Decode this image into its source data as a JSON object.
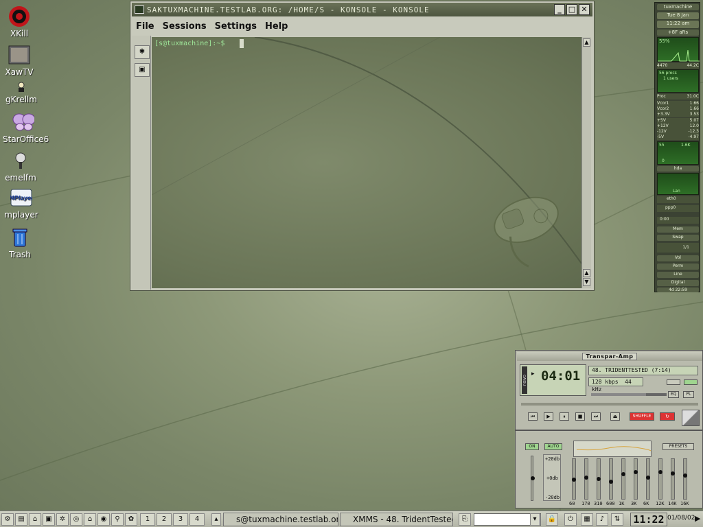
{
  "desktop_icons": [
    {
      "label": "XKill",
      "icon": "xkill-target-icon"
    },
    {
      "label": "XawTV",
      "icon": "xawtv-tv-icon"
    },
    {
      "label": "gKrellm",
      "icon": "gkrellm-monitor-icon"
    },
    {
      "label": "StarOffice6",
      "icon": "staroffice-butterfly-icon"
    },
    {
      "label": "emelfm",
      "icon": "emelfm-filemanager-icon"
    },
    {
      "label": "mplayer",
      "icon": "mplayer-icon"
    },
    {
      "label": "Trash",
      "icon": "trash-can-icon"
    }
  ],
  "konsole": {
    "title": "SAKTUXMACHINE.TESTLAB.ORG: /HOME/S - KONSOLE - KONSOLE",
    "menu": [
      "File",
      "Sessions",
      "Settings",
      "Help"
    ],
    "prompt": "[s@tuxmachine]:~$",
    "colors": {
      "prompt": "#9fe79a"
    }
  },
  "gkrellm": {
    "host": "tuxmachine",
    "date": "Tue 8 Jan",
    "time": "11:22 am",
    "temp": "+8F aRs",
    "cpu": "55%",
    "cpu_readouts": [
      "4470",
      "44.2C"
    ],
    "procs": "56 procs",
    "users": "1 users",
    "proc_readouts": [
      "Proc",
      "31.0C"
    ],
    "volts": [
      {
        "label": "Vcor1",
        "value": "1.66"
      },
      {
        "label": "Vcor2",
        "value": "1.66"
      },
      {
        "label": "+3.3V",
        "value": "3.53"
      },
      {
        "label": "+5V",
        "value": "5.07"
      },
      {
        "label": "+12V",
        "value": "12.0"
      },
      {
        "label": "-12V",
        "value": "-12.3"
      },
      {
        "label": "-5V",
        "value": "-4.97"
      }
    ],
    "disk_label": "hda",
    "disk_readouts": [
      "55",
      "1.6K",
      "0"
    ],
    "net_label": "Lan",
    "eth": "eth0",
    "ppp": "ppp0",
    "uptime_small": "0:00",
    "mem": "Mem",
    "swap": "Swap",
    "mail": "1/1",
    "vol": "Vol",
    "perm": "Perm",
    "line": "Line",
    "digital": "Digital",
    "uptime": "4d 22:59"
  },
  "xmms": {
    "title": "Transpar-Amp",
    "time": "04:01",
    "song": "48. TRIDENTTESTED (7:14)",
    "bitrate": "128 kbps",
    "khz": "44 kHz",
    "eq_label": "EQ",
    "pl_label": "PL",
    "shuffle": "SHUFFLE",
    "clutterbar": "OAIDU"
  },
  "equalizer": {
    "on": "ON",
    "auto": "AUTO",
    "presets": "PRESETS",
    "db_labels": [
      "+20db",
      "+0db",
      "-20db"
    ],
    "bands": [
      "60",
      "170",
      "310",
      "600",
      "1K",
      "3K",
      "6K",
      "12K",
      "14K",
      "16K"
    ],
    "preamp": 0.5,
    "levels": [
      0.5,
      0.45,
      0.48,
      0.55,
      0.35,
      0.3,
      0.45,
      0.3,
      0.33,
      0.38
    ]
  },
  "taskbar": {
    "desktops": [
      "1",
      "2",
      "3",
      "4"
    ],
    "tasks": [
      "s@tuxmachine.testlab.org",
      "XMMS - 48. TridentTested"
    ],
    "clock": "11:22",
    "date": "01/08/02"
  }
}
